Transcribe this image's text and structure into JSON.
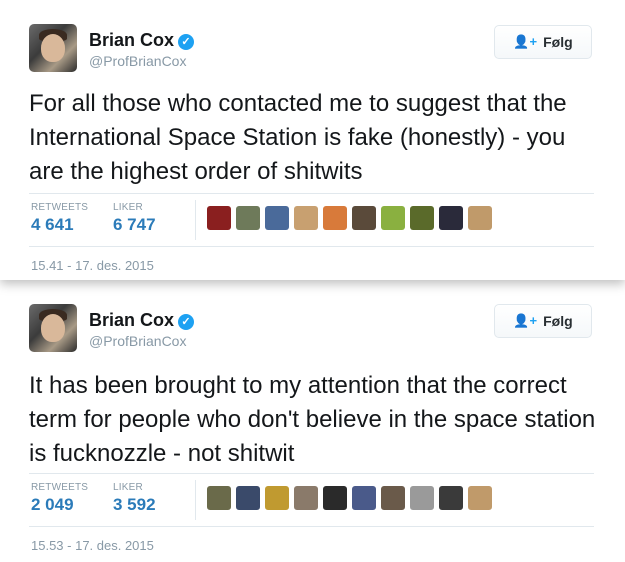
{
  "tweets": [
    {
      "name": "Brian Cox",
      "handle": "@ProfBrianCox",
      "follow_label": "Følg",
      "text": "For all those who contacted me to suggest that the International Space Station is fake (honestly) - you are the highest order of shitwits",
      "retweets_label": "RETWEETS",
      "retweets": "4 641",
      "likes_label": "LIKER",
      "likes": "6 747",
      "timestamp": "15.41 - 17. des. 2015",
      "liker_colors": [
        "#8a1f1f",
        "#6e7a5a",
        "#4a6a9a",
        "#c8a070",
        "#d87a3a",
        "#5a4a3a",
        "#8ab040",
        "#5a6a2a",
        "#2a2a3a",
        "#c09a6a"
      ]
    },
    {
      "name": "Brian Cox",
      "handle": "@ProfBrianCox",
      "follow_label": "Følg",
      "text": "It has been brought to my attention that the correct term for people who don't believe in the space station is fucknozzle - not shitwit",
      "retweets_label": "RETWEETS",
      "retweets": "2 049",
      "likes_label": "LIKER",
      "likes": "3 592",
      "timestamp": "15.53 - 17. des. 2015",
      "liker_colors": [
        "#6a6a4a",
        "#3a4a6a",
        "#c09a30",
        "#8a7a6a",
        "#2a2a2a",
        "#4a5a8a",
        "#6a5a4a",
        "#9a9a9a",
        "#3a3a3a",
        "#c09a6a"
      ]
    }
  ]
}
